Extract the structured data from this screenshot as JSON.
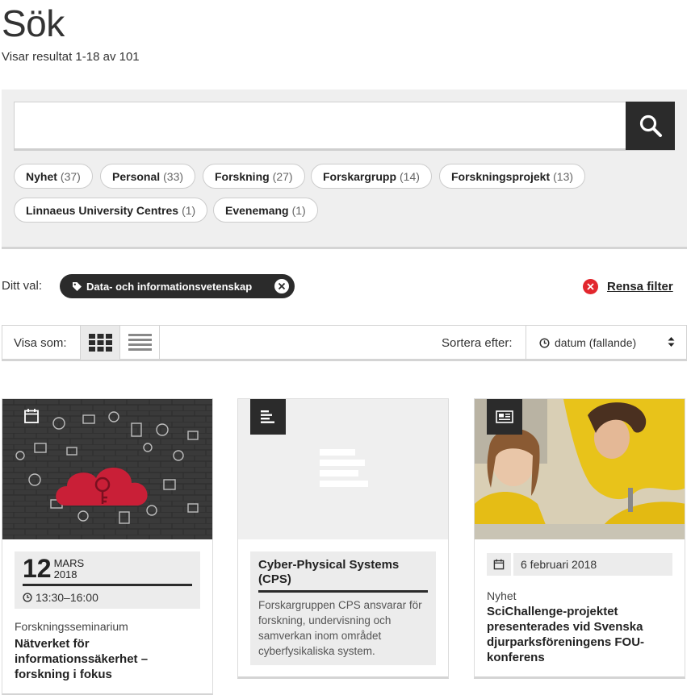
{
  "page": {
    "title": "Sök",
    "result_count": "Visar resultat 1-18 av 101"
  },
  "search": {
    "value": "",
    "placeholder": ""
  },
  "filters": [
    {
      "label": "Nyhet",
      "count": "(37)"
    },
    {
      "label": "Personal",
      "count": "(33)"
    },
    {
      "label": "Forskning",
      "count": "(27)"
    },
    {
      "label": "Forskargrupp",
      "count": "(14)"
    },
    {
      "label": "Forskningsprojekt",
      "count": "(13)"
    },
    {
      "label": "Linnaeus University Centres",
      "count": "(1)"
    },
    {
      "label": "Evenemang",
      "count": "(1)"
    }
  ],
  "selection": {
    "label": "Ditt val:",
    "active_tag": "Data- och informationsvetenskap",
    "clear_label": "Rensa filter"
  },
  "toolbar": {
    "view_label": "Visa som:",
    "sort_label": "Sortera efter:",
    "sort_value": "datum (fallande)"
  },
  "cards": [
    {
      "type_icon": "calendar-icon",
      "date_day": "12",
      "date_month": "MARS",
      "date_year": "2018",
      "time": "13:30–16:00",
      "category": "Forskningsseminarium",
      "title": "Nätverket för informationssäkerhet – forskning i fokus"
    },
    {
      "type_icon": "text-lines-icon",
      "title": "Cyber-Physical Systems (CPS)",
      "description": "Forskargruppen CPS ansvarar för forskning, undervisning och samverkan inom området cyberfysikaliska system."
    },
    {
      "type_icon": "newspaper-icon",
      "date": "6 februari 2018",
      "category": "Nyhet",
      "title": "SciChallenge-projektet presenterades vid Svenska djurparksföreningens FOU-konferens"
    }
  ],
  "colors": {
    "dark": "#2b2b2b",
    "panel": "#efefef",
    "accent_red": "#e2262d",
    "photo_yellow": "#e8c31a",
    "cloud_red": "#c91f37"
  }
}
